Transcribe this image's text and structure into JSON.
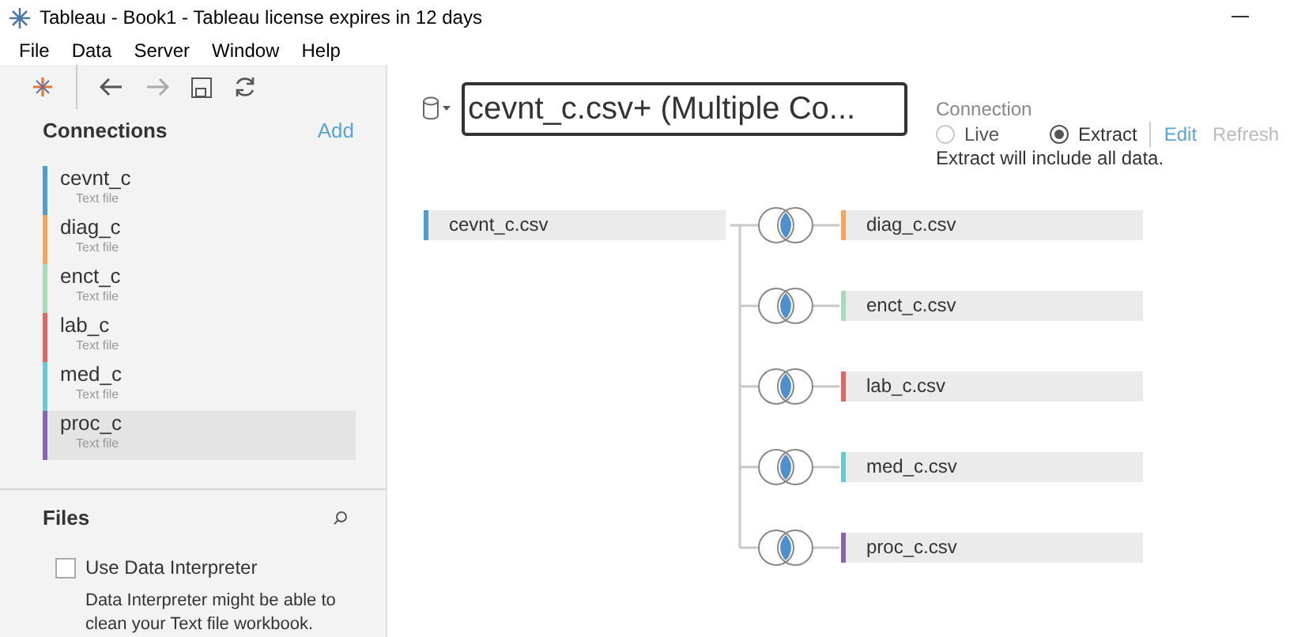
{
  "window": {
    "title": "Tableau - Book1 - Tableau license expires in 12 days"
  },
  "menu": [
    "File",
    "Data",
    "Server",
    "Window",
    "Help"
  ],
  "connections": {
    "heading": "Connections",
    "add": "Add",
    "items": [
      {
        "name": "cevnt_c",
        "type": "Text file",
        "color": "#4e9fcf",
        "selected": false
      },
      {
        "name": "diag_c",
        "type": "Text file",
        "color": "#f5a55b",
        "selected": false
      },
      {
        "name": "enct_c",
        "type": "Text file",
        "color": "#a8dcb8",
        "selected": false
      },
      {
        "name": "lab_c",
        "type": "Text file",
        "color": "#e06666",
        "selected": false
      },
      {
        "name": "med_c",
        "type": "Text file",
        "color": "#6cc8cf",
        "selected": false
      },
      {
        "name": "proc_c",
        "type": "Text file",
        "color": "#8566b0",
        "selected": true
      }
    ]
  },
  "files": {
    "heading": "Files",
    "interpreter": {
      "label": "Use Data Interpreter",
      "checked": false
    },
    "description": "Data Interpreter might be able to clean your Text file workbook."
  },
  "data_source": {
    "name": "cevnt_c.csv+ (Multiple Co...",
    "connection_label": "Connection",
    "options": [
      {
        "label": "Live",
        "selected": false
      },
      {
        "label": "Extract",
        "selected": true
      }
    ],
    "edit": "Edit",
    "refresh": "Refresh",
    "note": "Extract will include all data."
  },
  "join": {
    "left": {
      "name": "cevnt_c.csv",
      "color": "#4e9fcf"
    },
    "right": [
      {
        "name": "diag_c.csv",
        "color": "#f5a55b"
      },
      {
        "name": "enct_c.csv",
        "color": "#a8dcb8"
      },
      {
        "name": "lab_c.csv",
        "color": "#e06666"
      },
      {
        "name": "med_c.csv",
        "color": "#6cc8cf"
      },
      {
        "name": "proc_c.csv",
        "color": "#8566b0"
      }
    ]
  }
}
